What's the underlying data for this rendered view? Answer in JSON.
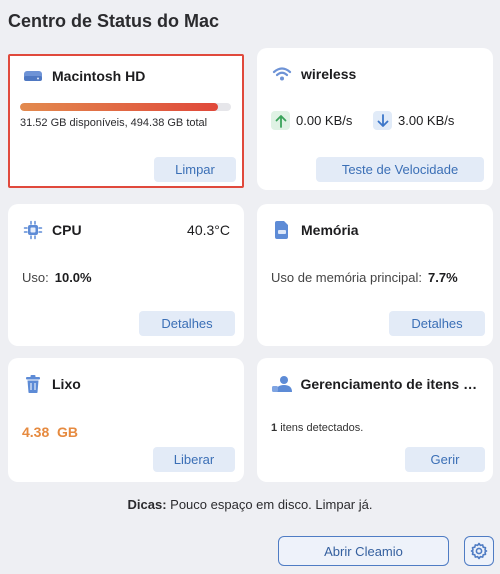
{
  "window": {
    "title": "Centro de Status do Mac"
  },
  "disk": {
    "title": "Macintosh HD",
    "used_fraction": 0.94,
    "usage_text": "31.52 GB disponíveis, 494.38 GB total",
    "button_label": "Limpar"
  },
  "wireless": {
    "title": "wireless",
    "upload": "0.00 KB/s",
    "download": "3.00 KB/s",
    "button_label": "Teste de Velocidade"
  },
  "cpu": {
    "title": "CPU",
    "temperature": "40.3°C",
    "usage_label": "Uso:",
    "usage_value": "10.0%",
    "button_label": "Detalhes"
  },
  "memory": {
    "title": "Memória",
    "usage_label": "Uso de memória principal:",
    "usage_value": "7.7%",
    "button_label": "Detalhes"
  },
  "trash": {
    "title": "Lixo",
    "size": "4.38  GB",
    "button_label": "Liberar"
  },
  "items": {
    "title": "Gerenciamento de itens d...",
    "count": "1",
    "detected_text": "itens detectados.",
    "button_label": "Gerir"
  },
  "tips": {
    "label": "Dicas:",
    "text": "Pouco espaço em disco. Limpar já."
  },
  "footer": {
    "open_button_label": "Abrir Cleamio"
  },
  "colors": {
    "accent": "#3b6fb6",
    "warning": "#e0493c",
    "trash_value": "#e68a3f",
    "upload_green": "#3aa35a",
    "download_blue": "#3b76c9"
  }
}
